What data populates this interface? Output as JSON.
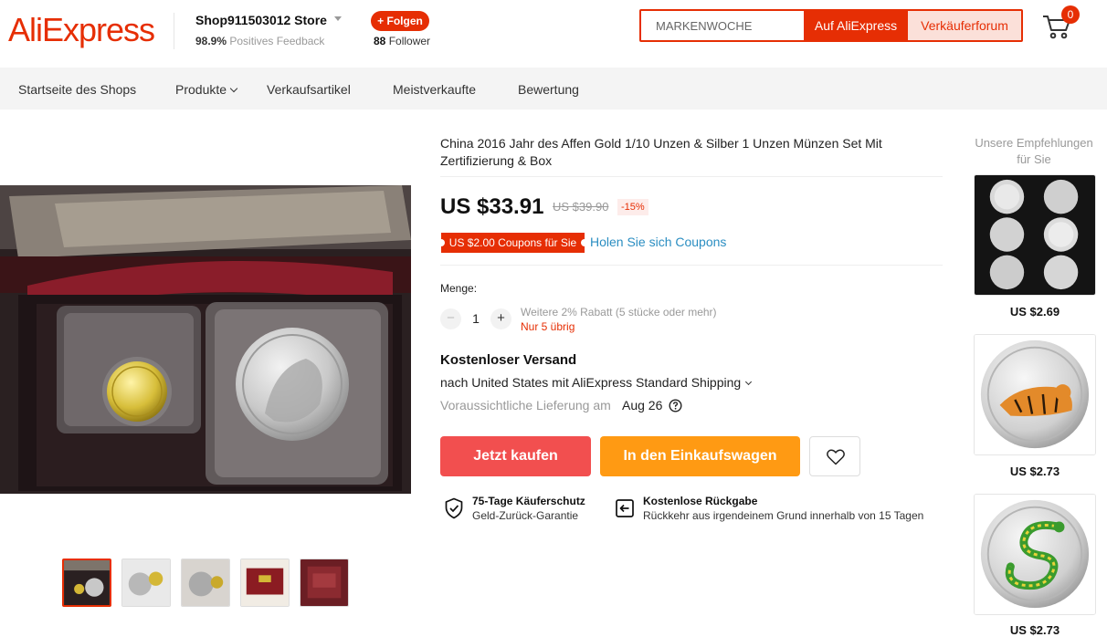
{
  "header": {
    "logo": "AliExpress",
    "store_name": "Shop911503012 Store",
    "feedback_percent": "98.9%",
    "feedback_label": "Positives Feedback",
    "follow_label": "+ Folgen",
    "follower_count": "88",
    "follower_label": "Follower",
    "search_placeholder": "MARKENWOCHE",
    "search_ali_label": "Auf AliExpress",
    "search_seller_label": "Verkäuferforum",
    "cart_count": "0"
  },
  "nav": {
    "items": [
      {
        "label": "Startseite des Shops"
      },
      {
        "label": "Produkte"
      },
      {
        "label": "Verkaufsartikel"
      },
      {
        "label": "Meistverkaufte"
      },
      {
        "label": "Bewertung"
      }
    ]
  },
  "product": {
    "title": "China 2016 Jahr des Affen Gold 1/10 Unzen & Silber 1 Unzen Münzen Set Mit Zertifizierung & Box",
    "price": "US $33.91",
    "old_price": "US $39.90",
    "discount": "-15%",
    "coupon": "US $2.00 Coupons für Sie",
    "get_coupons": "Holen Sie sich Coupons",
    "quantity_label": "Menge:",
    "quantity_value": "1",
    "quantity_minus": "−",
    "quantity_plus": "+",
    "quantity_discount": "Weitere 2% Rabatt (5 stücke oder mehr)",
    "stock_left": "Nur 5 übrig",
    "shipping_title": "Kostenloser Versand",
    "shipping_via": "nach United States mit AliExpress Standard Shipping",
    "delivery_label": "Voraussichtliche Lieferung am",
    "delivery_date": "Aug 26",
    "buy_now": "Jetzt kaufen",
    "add_to_cart": "In den Einkaufswagen",
    "guarantee_1_title": "75-Tage Käuferschutz",
    "guarantee_1_sub": "Geld-Zurück-Garantie",
    "guarantee_2_title": "Kostenlose Rückgabe",
    "guarantee_2_sub": "Rückkehr aus irgendeinem Grund innerhalb von 15 Tagen"
  },
  "recommendations": {
    "title": "Unsere Empfehlungen für Sie",
    "items": [
      {
        "price": "US $2.69"
      },
      {
        "price": "US $2.73"
      },
      {
        "price": "US $2.73"
      }
    ]
  },
  "colors": {
    "brand": "#e62e04",
    "buy_button": "#f24f4f",
    "cart_button": "#ff9a13",
    "link": "#2b8ec2"
  },
  "icons": [
    "cart-icon",
    "chevron-down-icon",
    "help-icon",
    "heart-icon",
    "shield-check-icon",
    "return-icon"
  ]
}
